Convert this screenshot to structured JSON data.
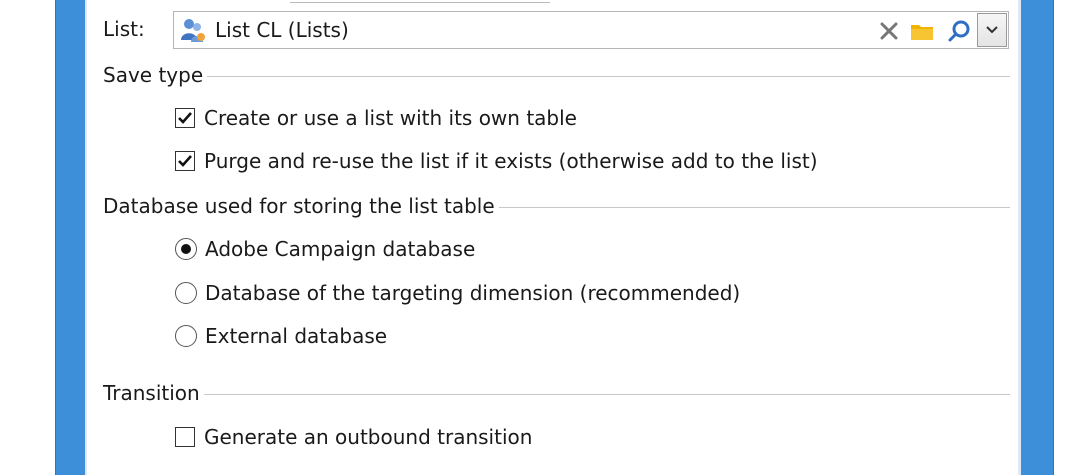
{
  "list": {
    "label": "List:",
    "value": "List CL (Lists)",
    "icons": [
      "list-people-icon",
      "clear-x-icon",
      "folder-icon",
      "search-icon",
      "chevron-down-icon"
    ]
  },
  "save_type": {
    "title": "Save type",
    "options": [
      {
        "label": "Create or use a list with its own table",
        "checked": true
      },
      {
        "label": "Purge and re-use the list if it exists (otherwise add to the list)",
        "checked": true
      }
    ]
  },
  "database": {
    "title": "Database used for storing the list table",
    "options": [
      {
        "label": "Adobe Campaign database",
        "selected": true
      },
      {
        "label": "Database of the targeting dimension (recommended)",
        "selected": false
      },
      {
        "label": "External database",
        "selected": false
      }
    ]
  },
  "transition": {
    "title": "Transition",
    "options": [
      {
        "label": "Generate an outbound transition",
        "checked": false
      }
    ]
  },
  "colors": {
    "window_border": "#3d8fd9",
    "folder": "#f0b400",
    "search": "#2e6fc4"
  }
}
